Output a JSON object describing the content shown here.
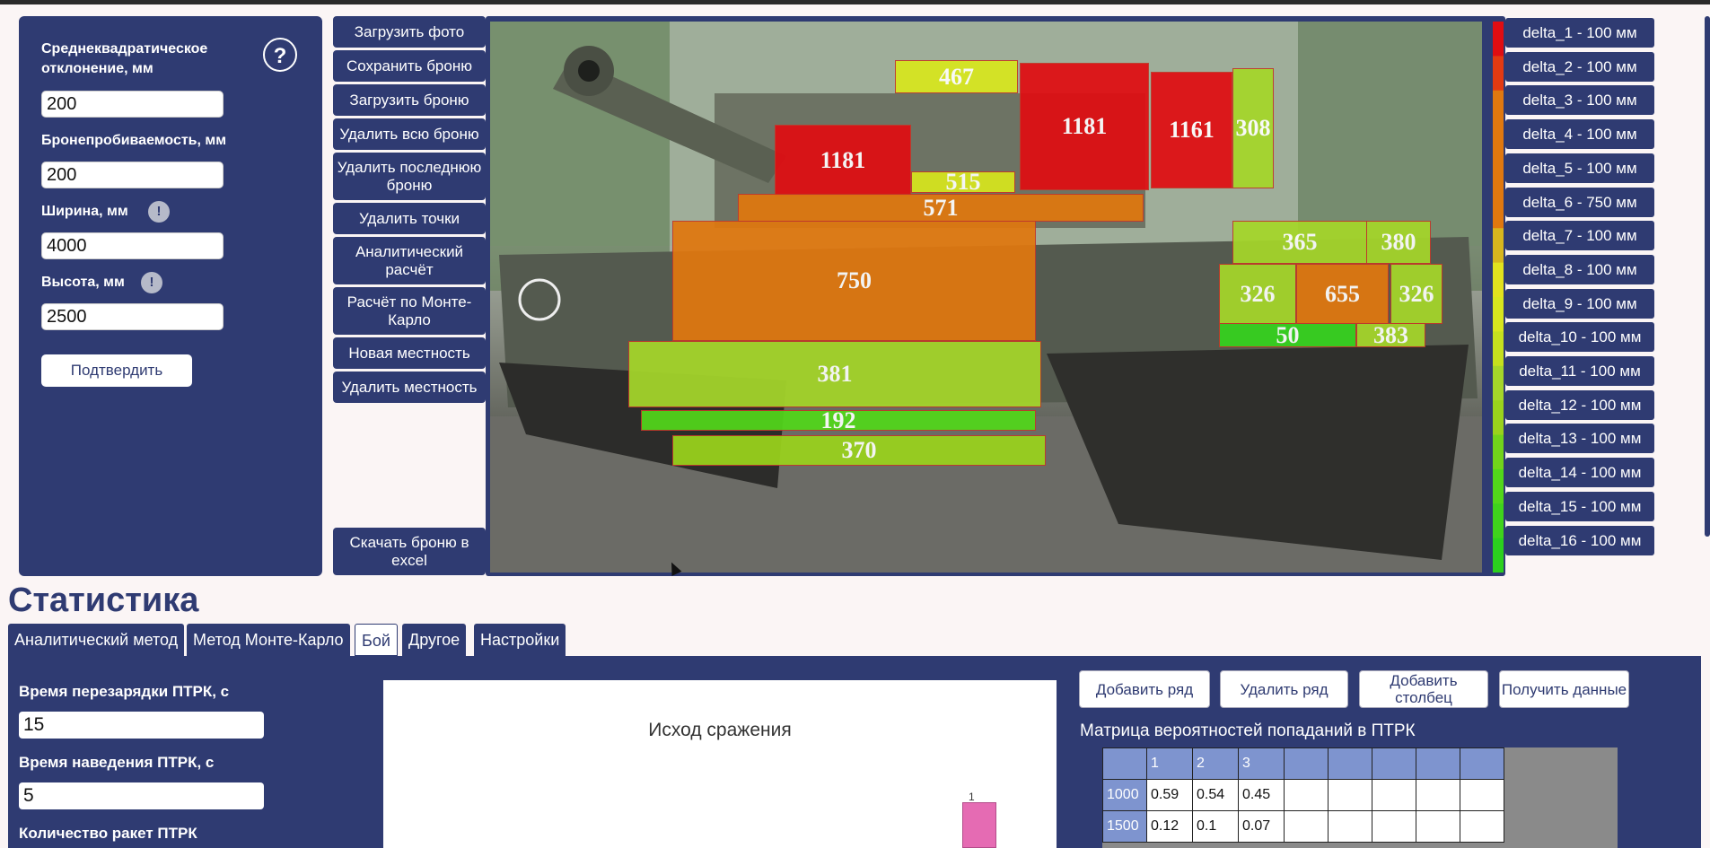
{
  "left_panel": {
    "sigma_label": "Среднеквадратическое отклонение, мм",
    "sigma_value": "200",
    "penetration_label": "Бронепробиваемость, мм",
    "penetration_value": "200",
    "width_label": "Ширина, мм",
    "width_value": "4000",
    "height_label": "Высота, мм",
    "height_value": "2500",
    "help_icon": "?",
    "info_icon": "!",
    "confirm_label": "Подтвердить"
  },
  "menu": {
    "load_photo": "Загрузить фото",
    "save_armor": "Сохранить броню",
    "load_armor": "Загрузить броню",
    "delete_all_armor": "Удалить всю броню",
    "delete_last_armor": "Удалить последнюю броню",
    "delete_points": "Удалить точки",
    "analytic_calc": "Аналитический расчёт",
    "monte_carlo_calc": "Расчёт по Монте-Карло",
    "new_terrain": "Новая местность",
    "delete_terrain": "Удалить местность",
    "download_excel": "Скачать броню в excel"
  },
  "armor_blocks": [
    {
      "value": "467",
      "color": "#d7e61e"
    },
    {
      "value": "1181",
      "color": "#e00d12"
    },
    {
      "value": "1161",
      "color": "#e00d12"
    },
    {
      "value": "308",
      "color": "#a5d62a"
    },
    {
      "value": "1181",
      "color": "#e00d12"
    },
    {
      "value": "515",
      "color": "#d7e61e"
    },
    {
      "value": "571",
      "color": "#e0780f"
    },
    {
      "value": "750",
      "color": "#e0780f"
    },
    {
      "value": "365",
      "color": "#a5d62a"
    },
    {
      "value": "380",
      "color": "#a5d62a"
    },
    {
      "value": "326",
      "color": "#a5d62a"
    },
    {
      "value": "655",
      "color": "#e0780f"
    },
    {
      "value": "326",
      "color": "#a5d62a"
    },
    {
      "value": "50",
      "color": "#35d31e"
    },
    {
      "value": "383",
      "color": "#a5d62a"
    },
    {
      "value": "381",
      "color": "#a5d62a"
    },
    {
      "value": "192",
      "color": "#52d71a"
    },
    {
      "value": "370",
      "color": "#9ad31c"
    }
  ],
  "legend": [
    {
      "label": "delta_1 - 100 мм",
      "color": "#e00d12"
    },
    {
      "label": "delta_2 - 100 мм",
      "color": "#e33a12"
    },
    {
      "label": "delta_3 - 100 мм",
      "color": "#e0780f"
    },
    {
      "label": "delta_4 - 100 мм",
      "color": "#e0780f"
    },
    {
      "label": "delta_5 - 100 мм",
      "color": "#e0780f"
    },
    {
      "label": "delta_6 - 750 мм",
      "color": "#e0780f"
    },
    {
      "label": "delta_7 - 100 мм",
      "color": "#d7b61e"
    },
    {
      "label": "delta_8 - 100 мм",
      "color": "#e2e21e"
    },
    {
      "label": "delta_9 - 100 мм",
      "color": "#d7e61e"
    },
    {
      "label": "delta_10 - 100 мм",
      "color": "#c5e01e"
    },
    {
      "label": "delta_11 - 100 мм",
      "color": "#a5d62a"
    },
    {
      "label": "delta_12 - 100 мм",
      "color": "#9ad31c"
    },
    {
      "label": "delta_13 - 100 мм",
      "color": "#72d41b"
    },
    {
      "label": "delta_14 - 100 мм",
      "color": "#52d71a"
    },
    {
      "label": "delta_15 - 100 мм",
      "color": "#3fd31c"
    },
    {
      "label": "delta_16 - 100 мм",
      "color": "#2bd01e"
    }
  ],
  "stats": {
    "title": "Статистика",
    "tabs": [
      "Аналитический метод",
      "Метод Монте-Карло",
      "Бой",
      "Другое",
      "Настройки"
    ],
    "active_tab": "Бой",
    "reload_label": "Время перезарядки ПТРК, с",
    "reload_value": "15",
    "aim_label": "Время наведения ПТРК, с",
    "aim_value": "5",
    "missiles_label": "Количество ракет ПТРК"
  },
  "chart": {
    "title": "Исход сражения",
    "bar_label": "1",
    "bar_color": "#e56bb3"
  },
  "actions": {
    "add_row": "Добавить ряд",
    "delete_row": "Удалить ряд",
    "add_column": "Добавить столбец",
    "get_data": "Получить данные"
  },
  "matrix": {
    "title": "Матрица вероятностей попаданий в ПТРК",
    "headers": [
      "",
      "1",
      "2",
      "3",
      "",
      "",
      "",
      "",
      ""
    ],
    "rows": [
      [
        "1000",
        "0.59",
        "0.54",
        "0.45",
        "",
        "",
        "",
        "",
        ""
      ],
      [
        "1500",
        "0.12",
        "0.1",
        "0.07",
        "",
        "",
        "",
        "",
        ""
      ]
    ]
  }
}
